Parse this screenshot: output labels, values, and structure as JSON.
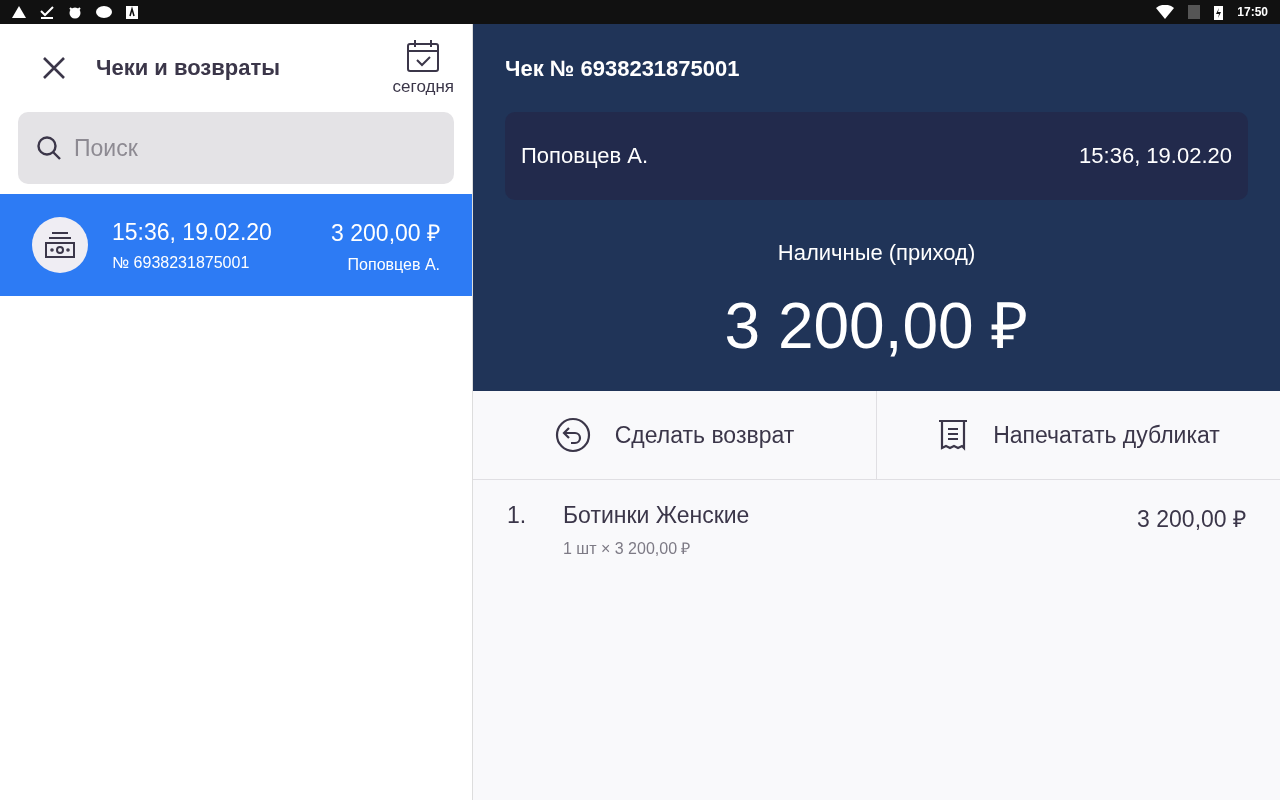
{
  "status_bar": {
    "time": "17:50"
  },
  "sidebar": {
    "title": "Чеки и возвраты",
    "date_filter": "сегодня",
    "search": {
      "placeholder": "Поиск"
    },
    "receipts": [
      {
        "time": "15:36, 19.02.20",
        "number": "№ 6938231875001",
        "amount": "3 200,00 ₽",
        "cashier": "Поповцев А.",
        "selected": true
      }
    ]
  },
  "receipt": {
    "title": "Чек № 6938231875001",
    "cashier": "Поповцев А.",
    "time": "15:36, 19.02.20",
    "payment_type": "Наличные (приход)",
    "total": "3 200,00 ₽",
    "actions": [
      {
        "kind": "return",
        "label": "Сделать возврат"
      },
      {
        "kind": "print",
        "label": "Напечатать дубликат"
      }
    ],
    "items": [
      {
        "index": "1.",
        "name": "Ботинки Женские",
        "quantity": "1 шт × 3 200,00 ₽",
        "price": "3 200,00 ₽"
      }
    ]
  }
}
